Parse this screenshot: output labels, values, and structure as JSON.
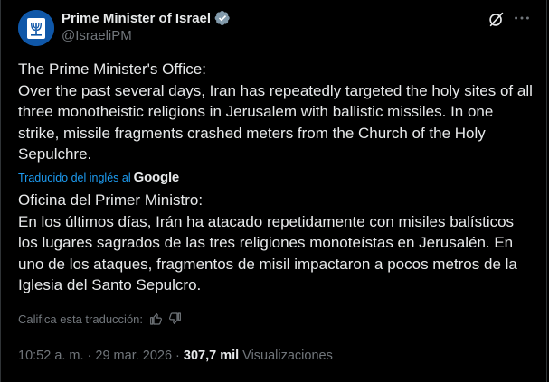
{
  "author": {
    "name": "Prime Minister of Israel",
    "handle": "@IsraeliPM",
    "avatar_icon": "israel-emblem-icon",
    "verified_color": "#829aab"
  },
  "header_actions": {
    "grok_icon": "grok-icon",
    "more_icon": "more-dots-icon"
  },
  "post": {
    "original_text": "The Prime Minister's Office:\nOver the past several days, Iran has repeatedly targeted the holy sites of all three monotheistic religions in Jerusalem with ballistic missiles. In one strike, missile fragments crashed meters from the Church of the Holy Sepulchre.",
    "translation_credit": "Traducido del inglés al",
    "translation_provider": "Google",
    "translated_text": "Oficina del Primer Ministro:\nEn los últimos días, Irán ha atacado repetidamente con misiles balísticos los lugares sagrados de las tres religiones monoteístas en Jerusalén. En uno de los ataques, fragmentos de misil impactaron a pocos metros de la Iglesia del Santo Sepulcro."
  },
  "rating": {
    "label": "Califica esta traducción:",
    "thumbs_up_icon": "thumbs-up-icon",
    "thumbs_down_icon": "thumbs-down-icon"
  },
  "meta": {
    "time": "10:52 a. m.",
    "separator": "·",
    "date": "29 mar. 2026",
    "views_count": "307,7 mil",
    "views_label": "Visualizaciones"
  },
  "colors": {
    "background": "#000000",
    "text_primary": "#e7e9ea",
    "text_secondary": "#71767b",
    "link": "#1d9bf0",
    "border": "#2f3336"
  }
}
